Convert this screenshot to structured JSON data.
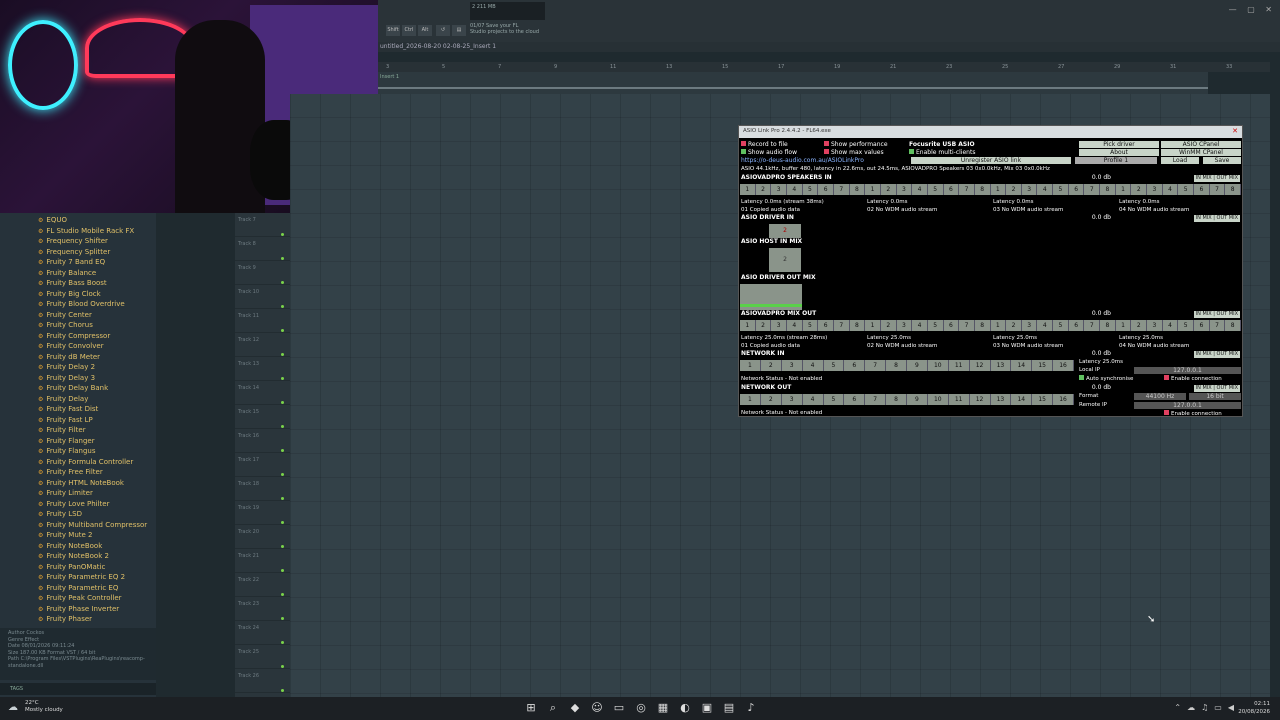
{
  "fl_top": {
    "meter_text": "2   211 MB",
    "meter_sub": "0",
    "hint_title": "01/07  Save your FL",
    "hint_body": "Studio projects to the cloud",
    "btn_shift": "Shift",
    "btn_ctrl": "Ctrl",
    "btn_alt": "Alt"
  },
  "project_title": "untitled_2026-08-20 02-08-25_Insert 1",
  "ruler_marks": [
    "3",
    "5",
    "7",
    "9",
    "11",
    "13",
    "15",
    "17",
    "19",
    "21",
    "23",
    "25",
    "27",
    "29",
    "31",
    "33"
  ],
  "lane1_label": "Insert 1",
  "browser_items": [
    "EQUO",
    "FL Studio Mobile Rack FX",
    "Frequency Shifter",
    "Frequency Splitter",
    "Fruity 7 Band EQ",
    "Fruity Balance",
    "Fruity Bass Boost",
    "Fruity Big Clock",
    "Fruity Blood Overdrive",
    "Fruity Center",
    "Fruity Chorus",
    "Fruity Compressor",
    "Fruity Convolver",
    "Fruity dB Meter",
    "Fruity Delay 2",
    "Fruity Delay 3",
    "Fruity Delay Bank",
    "Fruity Delay",
    "Fruity Fast Dist",
    "Fruity Fast LP",
    "Fruity Filter",
    "Fruity Flanger",
    "Fruity Flangus",
    "Fruity Formula Controller",
    "Fruity Free Filter",
    "Fruity HTML NoteBook",
    "Fruity Limiter",
    "Fruity Love Philter",
    "Fruity LSD",
    "Fruity Multiband Compressor",
    "Fruity Mute 2",
    "Fruity NoteBook",
    "Fruity NoteBook 2",
    "Fruity PanOMatic",
    "Fruity Parametric EQ 2",
    "Fruity Parametric EQ",
    "Fruity Peak Controller",
    "Fruity Phase Inverter",
    "Fruity Phaser"
  ],
  "info": {
    "author": "Author  Cockos",
    "genre": "Genre  Effect",
    "date": "Date  08/01/2026 09:11:24",
    "size": "Size  187.00 KB   Format  VST / 64 bit",
    "path": "Path  C:\\Program Files\\VSTPlugins\\ReaPlugins\\reacomp-standalone.dll"
  },
  "tags_label": "TAGS",
  "tracks": [
    "Track 7",
    "Track 8",
    "Track 9",
    "Track 10",
    "Track 11",
    "Track 12",
    "Track 13",
    "Track 14",
    "Track 15",
    "Track 16",
    "Track 17",
    "Track 18",
    "Track 19",
    "Track 20",
    "Track 21",
    "Track 22",
    "Track 23",
    "Track 24",
    "Track 25",
    "Track 26"
  ],
  "asio": {
    "title": "ASIO Link Pro 2.4.4.2 - FL64.exe",
    "record_to_file": "Record to file",
    "show_performance": "Show performance",
    "show_audio_flow": "Show audio flow",
    "show_max_values": "Show max values",
    "driver_name": "Focusrite USB ASIO",
    "enable_multi": "Enable multi-clients",
    "url": "https://o-deus-audio.com.au/ASIOLinkPro",
    "unregister": "Unregister ASIO link",
    "pick_driver": "Pick driver",
    "asio_cpanel": "ASIO CPanel",
    "about": "About",
    "winmm": "WinMM CPanel",
    "profile": "Profile 1",
    "load": "Load",
    "save": "Save",
    "status": "ASIO 44.1kHz, buffer 480, latency in 22.6ms, out 24.5ms, ASIOVADPRO Speakers 03 0x0.0kHz, Mix 03 0x0.0kHz",
    "sec_speakers_in": "ASIOVADPRO SPEAKERS IN",
    "sec_driver_in": "ASIO DRIVER IN",
    "sec_host_in_mix": "ASIO HOST IN MIX",
    "sec_driver_out_mix": "ASIO DRIVER OUT MIX",
    "sec_mix_out": "ASIOVADPRO MIX OUT",
    "sec_network_in": "NETWORK IN",
    "sec_network_out": "NETWORK OUT",
    "db": "0.0 db",
    "in_mix": "IN MIX",
    "out_mix": "OUT MIX",
    "lat_a1": "Latency 0.0ms (stream 38ms)",
    "lat_a2": "Latency 0.0ms",
    "lat_a3": "Latency 0.0ms",
    "lat_a4": "Latency 0.0ms",
    "sub_a1": "01 Copied audio data",
    "sub_a2": "02 No WDM audio stream",
    "sub_a3": "03 No WDM audio stream",
    "sub_a4": "04 No WDM audio stream",
    "lat_b1": "Latency 25.0ms (stream 28ms)",
    "lat_b2": "Latency 25.0ms",
    "lat_b3": "Latency 25.0ms",
    "lat_b4": "Latency 25.0ms",
    "sub_b1": "01 Copied audio data",
    "sub_b2": "02 No WDM audio stream",
    "sub_b3": "03 No WDM audio stream",
    "sub_b4": "04 No WDM audio stream",
    "net_latency": "Latency 25.0ms",
    "local_ip_label": "Local IP",
    "local_ip": "127.0.0.1",
    "auto_sync": "Auto synchronise",
    "enable_conn": "Enable connection",
    "net_status": "Network Status - Not enabled",
    "format_label": "Format",
    "format_rate": "44100 Hz",
    "format_bits": "16 bit",
    "remote_ip_label": "Remote IP",
    "remote_ip": "127.0.0.1",
    "chan_label_2": "2"
  },
  "taskbar": {
    "temp": "22°C",
    "weather": "Mostly cloudy",
    "time": "02:11",
    "date": "20/08/2026"
  }
}
